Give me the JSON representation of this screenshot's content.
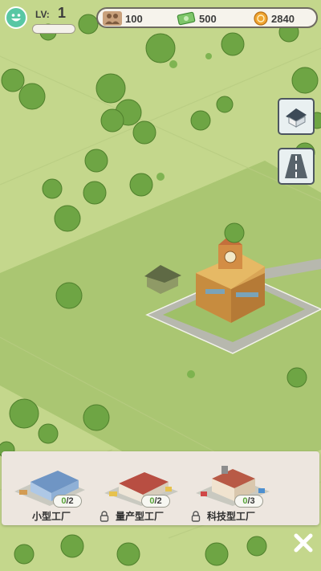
{
  "hud": {
    "level_label": "LV:",
    "level_value": "1",
    "population": "100",
    "cash": "500",
    "coins": "2840"
  },
  "side_buttons": [
    {
      "icon": "house-icon"
    },
    {
      "icon": "road-icon"
    }
  ],
  "factory_panel": {
    "cards": [
      {
        "name": "小型工厂",
        "count_current": "0",
        "count_total": "/2",
        "locked": false
      },
      {
        "name": "量产型工厂",
        "count_current": "0",
        "count_total": "/2",
        "locked": true
      },
      {
        "name": "科技型工厂",
        "count_current": "0",
        "count_total": "/3",
        "locked": true
      }
    ]
  },
  "colors": {
    "grass_light": "#c8d98e",
    "grass_dark": "#a9c56f",
    "tree": "#6ea544",
    "accent_green": "#59a33a"
  }
}
